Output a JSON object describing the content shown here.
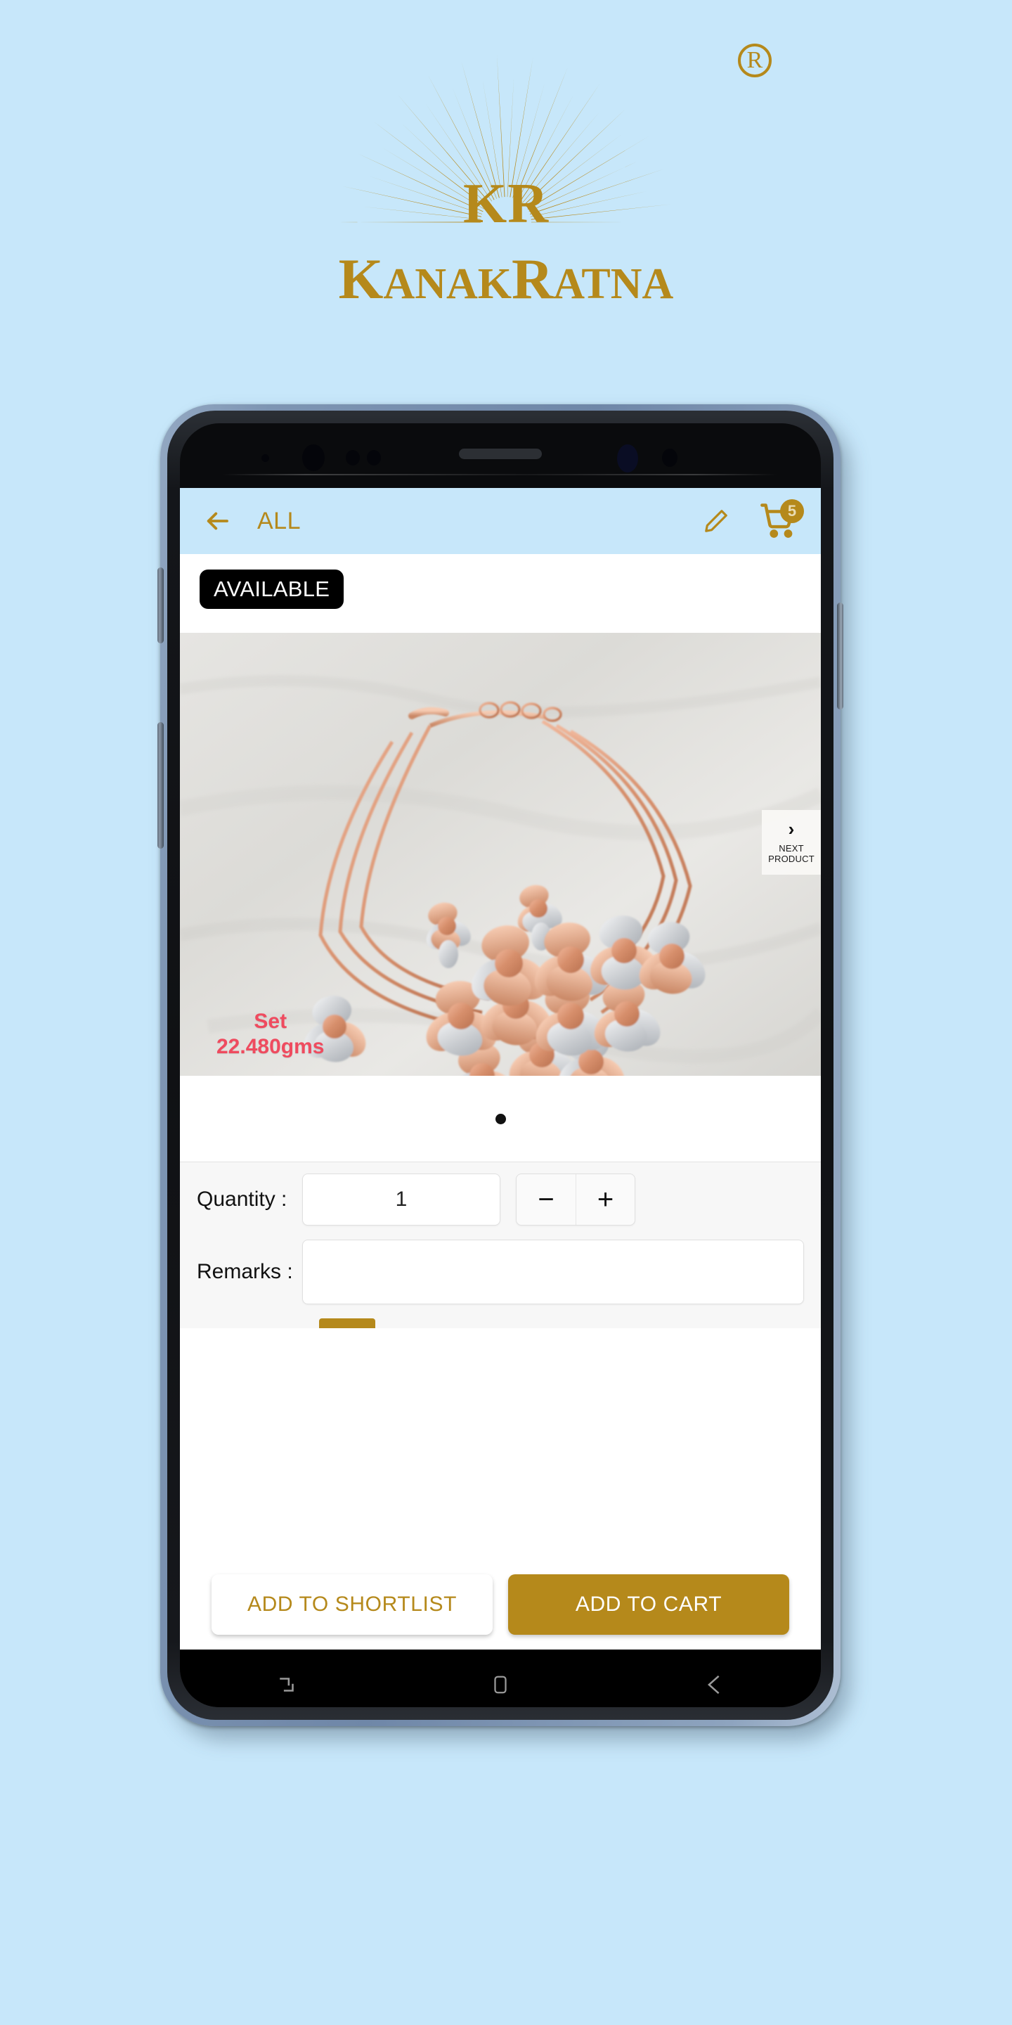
{
  "brand": {
    "monogram": "KR",
    "monogram_small": "R",
    "name_part1": "K",
    "name_part2": "ANAK",
    "name_part3": "R",
    "name_part4": "ATNA",
    "full_name": "KANAKRATNA",
    "registered_mark": "R",
    "color": "#b5891b",
    "background": "#c7e7fa"
  },
  "appbar": {
    "back_icon": "arrow-left-icon",
    "title": "ALL",
    "edit_icon": "pencil-icon",
    "cart_icon": "shopping-cart-icon",
    "cart_count": "5",
    "background": "#c7e7fa",
    "foreground": "#b5891b"
  },
  "product": {
    "availability_badge": "AVAILABLE",
    "weight_line1": "Set",
    "weight_line2": "22.480gms",
    "weight_color": "#ef4b5f",
    "next_product_chevron": "chevron-right-icon",
    "next_product_line1": "NEXT",
    "next_product_line2": "PRODUCT",
    "page_dots": 1,
    "active_dot": 0
  },
  "form": {
    "quantity_label": "Quantity :",
    "quantity_value": "1",
    "quantity_placeholder": "",
    "decrement_label": "−",
    "increment_label": "+",
    "remarks_label": "Remarks :",
    "remarks_value": "",
    "remarks_placeholder": ""
  },
  "actions": {
    "shortlist_label": "ADD TO SHORTLIST",
    "cart_label": "ADD TO CART",
    "shortlist_color": "#b5891b",
    "cart_bg": "#b5891b"
  },
  "navbar": {
    "recents_icon": "recents-icon",
    "home_icon": "home-icon",
    "back_icon": "back-icon"
  }
}
